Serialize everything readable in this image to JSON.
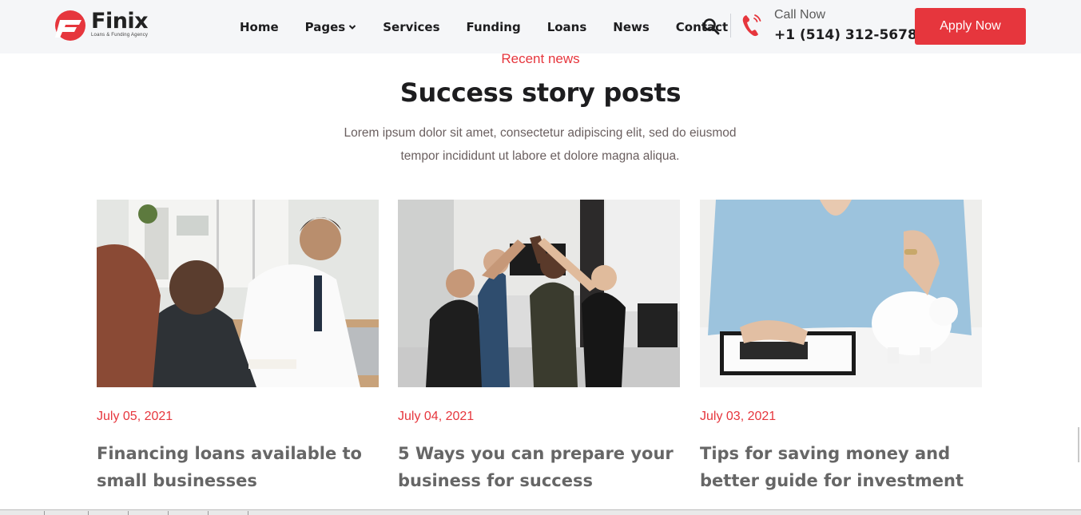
{
  "header": {
    "logo_name": "Finix",
    "logo_tagline": "Loans & Funding Agency",
    "nav": [
      {
        "label": "Home"
      },
      {
        "label": "Pages"
      },
      {
        "label": "Services"
      },
      {
        "label": "Funding"
      },
      {
        "label": "Loans"
      },
      {
        "label": "News"
      },
      {
        "label": "Contact"
      }
    ],
    "call_label": "Call Now",
    "call_number": "+1 (514) 312-5678",
    "apply_label": "Apply Now",
    "icons": {
      "search": "search-icon",
      "phone": "phone-icon",
      "dropdown": "chevron-down-icon"
    }
  },
  "section": {
    "eyebrow": "Recent news",
    "title": "Success story posts",
    "description_line1": "Lorem ipsum dolor sit amet, consectetur adipiscing elit, sed do eiusmod",
    "description_line2": "tempor incididunt ut labore et dolore magna aliqua."
  },
  "posts": [
    {
      "date": "July 05, 2021",
      "title_line1": "Financing loans available to",
      "title_line2": "small businesses"
    },
    {
      "date": "July 04, 2021",
      "title_line1": "5 Ways you can prepare your",
      "title_line2": "business for success"
    },
    {
      "date": "July 03, 2021",
      "title_line1": "Tips for saving money and",
      "title_line2": "better guide for investment"
    }
  ],
  "colors": {
    "accent": "#e6363d",
    "text_dark": "#1d1d1f",
    "header_bg": "#f5f6f8",
    "muted": "#6a5f5f"
  }
}
